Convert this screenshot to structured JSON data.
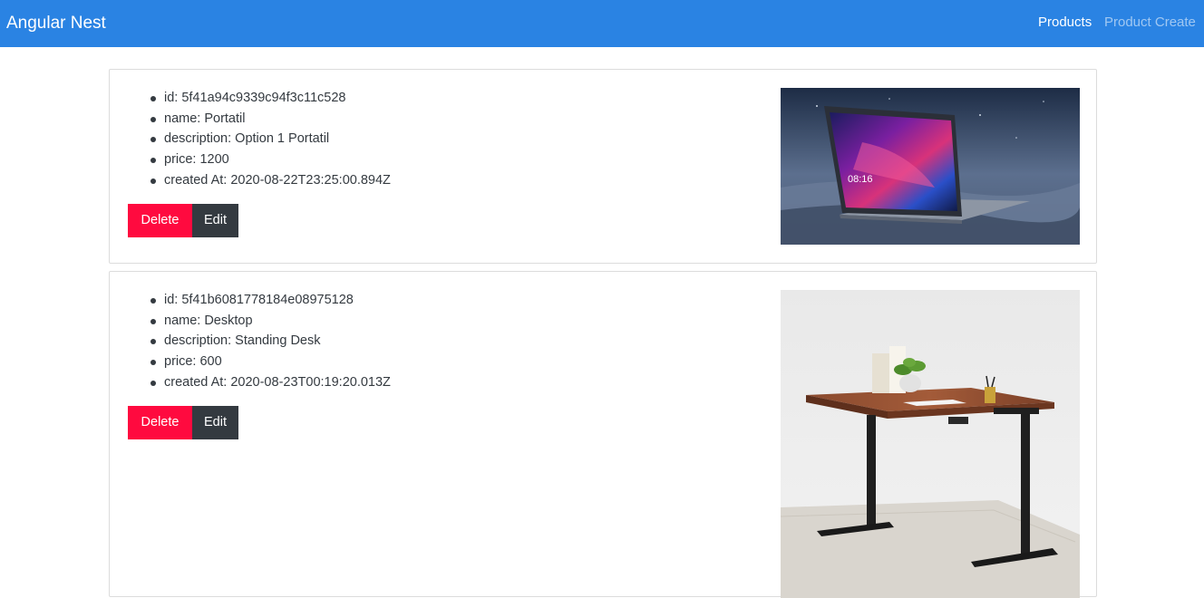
{
  "navbar": {
    "brand": "Angular Nest",
    "links": [
      {
        "label": "Products",
        "active": true
      },
      {
        "label": "Product Create",
        "active": false
      }
    ],
    "background": "#2a83e3"
  },
  "products": [
    {
      "fields": [
        "id: 5f41a94c9339c94f3c11c528",
        "name: Portatil",
        "description: Option 1 Portatil",
        "price: 1200",
        "created At: 2020-08-22T23:25:00.894Z"
      ],
      "delete_label": "Delete",
      "edit_label": "Edit",
      "image": "laptop-photo",
      "screen_time": "08:16"
    },
    {
      "fields": [
        "id: 5f41b6081778184e08975128",
        "name: Desktop",
        "description: Standing Desk",
        "price: 600",
        "created At: 2020-08-23T00:19:20.013Z"
      ],
      "delete_label": "Delete",
      "edit_label": "Edit",
      "image": "standing-desk-photo"
    }
  ],
  "colors": {
    "delete": "#ff0a3f",
    "edit": "#343a40",
    "text": "#343a40"
  }
}
